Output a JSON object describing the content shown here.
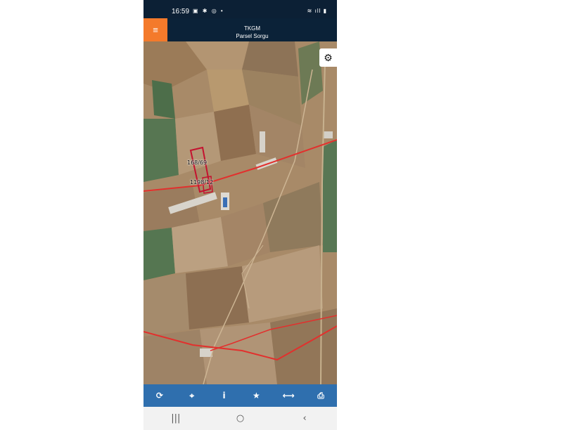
{
  "status": {
    "time": "16:59",
    "left_icons": "▣ ✱ ◎ •",
    "right_icons": "≋ ıll ▮"
  },
  "appbar": {
    "title_line1": "TKGM",
    "title_line2": "Parsel Sorgu",
    "menu_icon": "≡"
  },
  "map": {
    "parcel_labels": [
      "168/69",
      "1198/12"
    ],
    "settings_icon": "⚙"
  },
  "toolbar": {
    "refresh_icon": "⟳",
    "locate_icon": "⌖",
    "info_icon": "i",
    "favorite_icon": "★",
    "measure_icon": "⟷",
    "print_icon": "⎙"
  },
  "navbar": {
    "recents": "|||",
    "home": "○",
    "back": "‹"
  }
}
